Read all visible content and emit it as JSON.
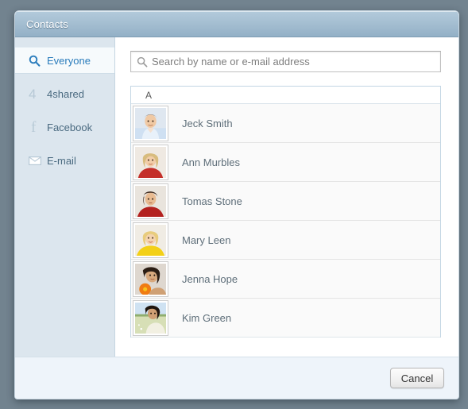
{
  "window": {
    "title": "Contacts",
    "titlebar_color": "#a5bfd2",
    "backdrop_color": "#72838f"
  },
  "sidebar": {
    "background_color": "#dce6ee",
    "active_text_color": "#2a7cbc",
    "items": [
      {
        "label": "Everyone",
        "icon": "search-icon",
        "active": true
      },
      {
        "label": "4shared",
        "icon": "4shared-icon",
        "active": false
      },
      {
        "label": "Facebook",
        "icon": "facebook-icon",
        "active": false
      },
      {
        "label": "E-mail",
        "icon": "envelope-icon",
        "active": false
      }
    ]
  },
  "search": {
    "placeholder": "Search by name or e-mail address",
    "value": "",
    "icon": "search-icon"
  },
  "contact_list": {
    "group_letter": "A",
    "contacts": [
      {
        "name": "Jeck Smith",
        "avatar": "photo-man-blue-shirt"
      },
      {
        "name": "Ann Murbles",
        "avatar": "photo-woman-blonde-red"
      },
      {
        "name": "Tomas Stone",
        "avatar": "photo-man-red-shirt"
      },
      {
        "name": "Mary Leen",
        "avatar": "photo-woman-yellow-top"
      },
      {
        "name": "Jenna Hope",
        "avatar": "photo-woman-orange-flower"
      },
      {
        "name": "Kim Green",
        "avatar": "photo-woman-field"
      }
    ]
  },
  "footer": {
    "cancel_label": "Cancel"
  }
}
